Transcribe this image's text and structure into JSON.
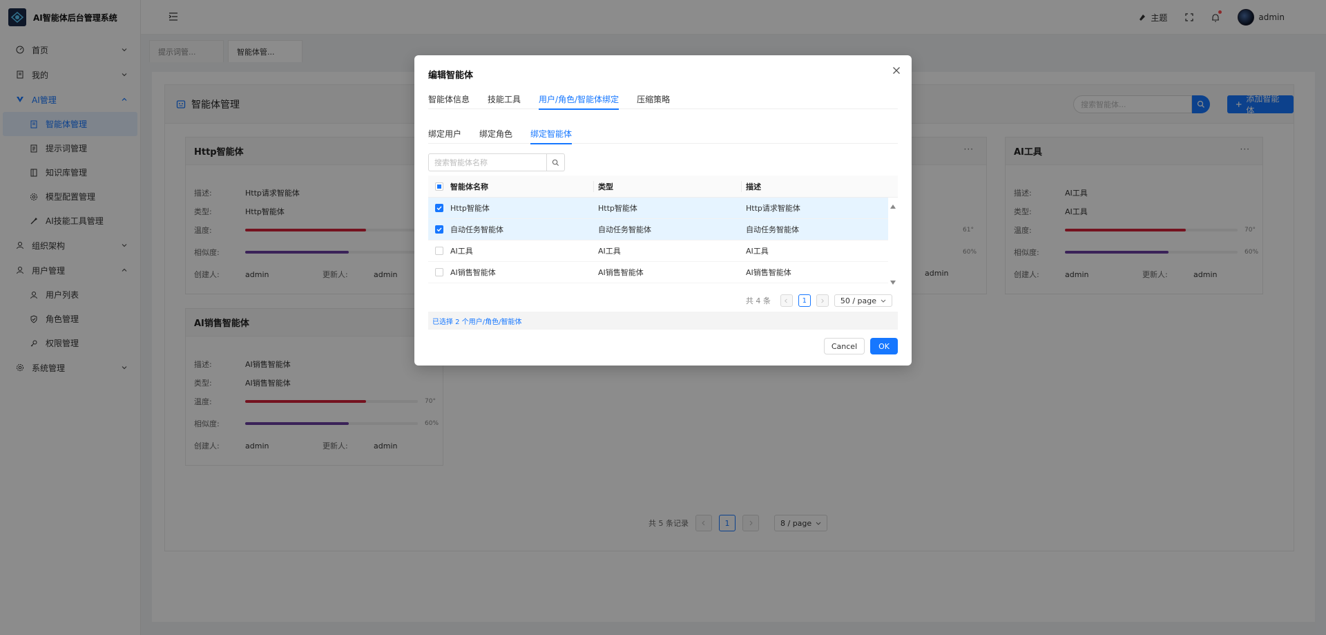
{
  "app": {
    "title": "AI智能体后台管理系统"
  },
  "sidebar": {
    "items": [
      {
        "label": "首页"
      },
      {
        "label": "我的"
      },
      {
        "label": "AI管理"
      },
      {
        "label": "组织架构"
      },
      {
        "label": "用户管理"
      },
      {
        "label": "系统管理"
      }
    ],
    "ai_sub": [
      {
        "label": "智能体管理"
      },
      {
        "label": "提示词管理"
      },
      {
        "label": "知识库管理"
      },
      {
        "label": "模型配置管理"
      },
      {
        "label": "AI技能工具管理"
      }
    ],
    "user_sub": [
      {
        "label": "用户列表"
      },
      {
        "label": "角色管理"
      },
      {
        "label": "权限管理"
      }
    ]
  },
  "header": {
    "theme_label": "主题",
    "username": "admin"
  },
  "tabs": [
    {
      "label": "提示词管..."
    },
    {
      "label": "智能体管..."
    }
  ],
  "page": {
    "title": "智能体管理",
    "search_placeholder": "搜索智能体...",
    "add_label": "添加智能体",
    "more": "···",
    "field_labels": {
      "desc": "描述:",
      "type": "类型:",
      "temp": "温度:",
      "sim": "相似度:",
      "creator": "创建人:",
      "updater": "更新人:"
    },
    "cards": [
      {
        "title": "Http智能体",
        "desc": "Http请求智能体",
        "type": "Http智能体",
        "temp_pct": "",
        "sim_pct": "",
        "temp": 0.7,
        "sim": 0.6,
        "creator": "admin",
        "updater": "admin"
      },
      {
        "title": "AI工具",
        "desc": "AI工具",
        "type": "AI工具",
        "temp_pct": "70°",
        "sim_pct": "60%",
        "temp": 0.7,
        "sim": 0.6,
        "creator": "admin",
        "updater": "admin"
      },
      {
        "title": "AI销售智能体",
        "desc": "AI销售智能体",
        "type": "AI销售智能体",
        "temp_pct": "70°",
        "sim_pct": "60%",
        "temp": 0.7,
        "sim": 0.6,
        "creator": "admin",
        "updater": "admin"
      }
    ],
    "partial": {
      "temp_pct": "61°",
      "sim_pct": "60%",
      "updater": "admin"
    },
    "pager": {
      "total": "共 5 条记录",
      "current": "1",
      "size": "8 / page"
    }
  },
  "modal": {
    "title": "编辑智能体",
    "tabs": [
      {
        "label": "智能体信息"
      },
      {
        "label": "技能工具"
      },
      {
        "label": "用户/角色/智能体绑定"
      },
      {
        "label": "压缩策略"
      }
    ],
    "subtabs": [
      {
        "label": "绑定用户"
      },
      {
        "label": "绑定角色"
      },
      {
        "label": "绑定智能体"
      }
    ],
    "search_placeholder": "搜索智能体名称",
    "columns": [
      "智能体名称",
      "类型",
      "描述"
    ],
    "rows": [
      {
        "name": "Http智能体",
        "type": "Http智能体",
        "desc": "Http请求智能体",
        "checked": true
      },
      {
        "name": "自动任务智能体",
        "type": "自动任务智能体",
        "desc": "自动任务智能体",
        "checked": true
      },
      {
        "name": "AI工具",
        "type": "AI工具",
        "desc": "AI工具",
        "checked": false
      },
      {
        "name": "AI销售智能体",
        "type": "AI销售智能体",
        "desc": "AI销售智能体",
        "checked": false
      }
    ],
    "pager": {
      "total": "共 4 条",
      "current": "1",
      "size": "50 / page"
    },
    "selected_text": "已选择 2 个用户/角色/智能体",
    "cancel_label": "Cancel",
    "ok_label": "OK"
  },
  "colors": {
    "primary": "#1677ff",
    "temp_bar": "#d4213a",
    "sim_bar": "#6b3fa0"
  }
}
